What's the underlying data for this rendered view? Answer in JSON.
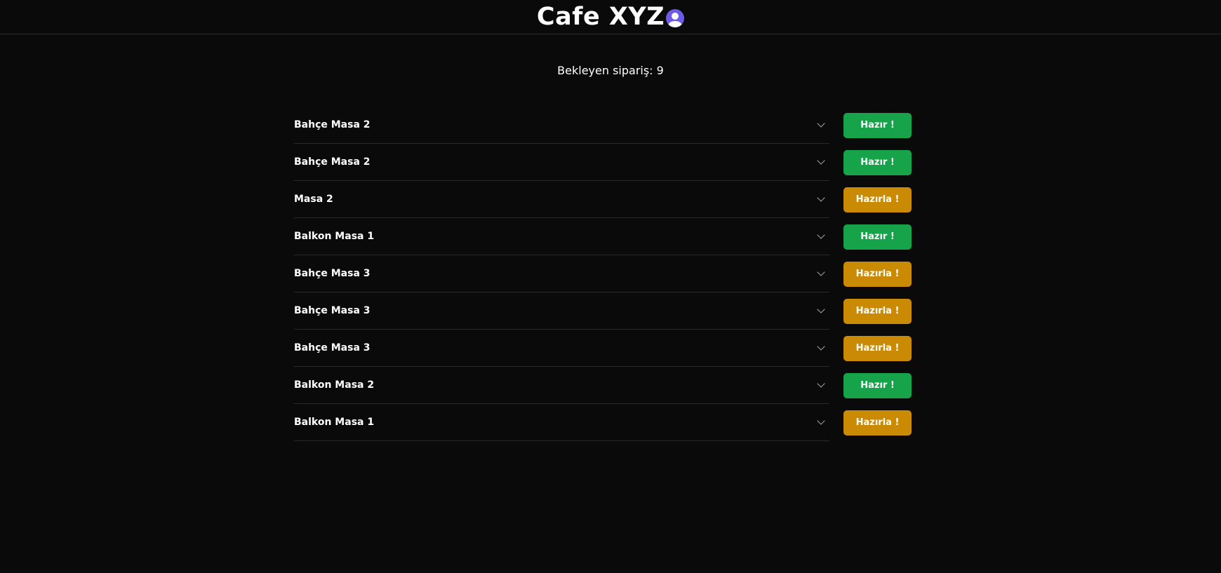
{
  "header": {
    "title": "Cafe XYZ",
    "avatar_icon": "user-avatar-icon"
  },
  "pending": {
    "text": "Bekleyen sipariş: 9"
  },
  "colors": {
    "ready": "#16a34a",
    "prepare": "#ca8a04"
  },
  "orders": [
    {
      "table": "Bahçe Masa 2",
      "action": "Hazır !",
      "status": "ready"
    },
    {
      "table": "Bahçe Masa 2",
      "action": "Hazır !",
      "status": "ready"
    },
    {
      "table": "Masa 2",
      "action": "Hazırla !",
      "status": "prepare"
    },
    {
      "table": "Balkon Masa 1",
      "action": "Hazır !",
      "status": "ready"
    },
    {
      "table": "Bahçe Masa 3",
      "action": "Hazırla !",
      "status": "prepare"
    },
    {
      "table": "Bahçe Masa 3",
      "action": "Hazırla !",
      "status": "prepare"
    },
    {
      "table": "Bahçe Masa 3",
      "action": "Hazırla !",
      "status": "prepare"
    },
    {
      "table": "Balkon Masa 2",
      "action": "Hazır !",
      "status": "ready"
    },
    {
      "table": "Balkon Masa 1",
      "action": "Hazırla !",
      "status": "prepare"
    }
  ]
}
